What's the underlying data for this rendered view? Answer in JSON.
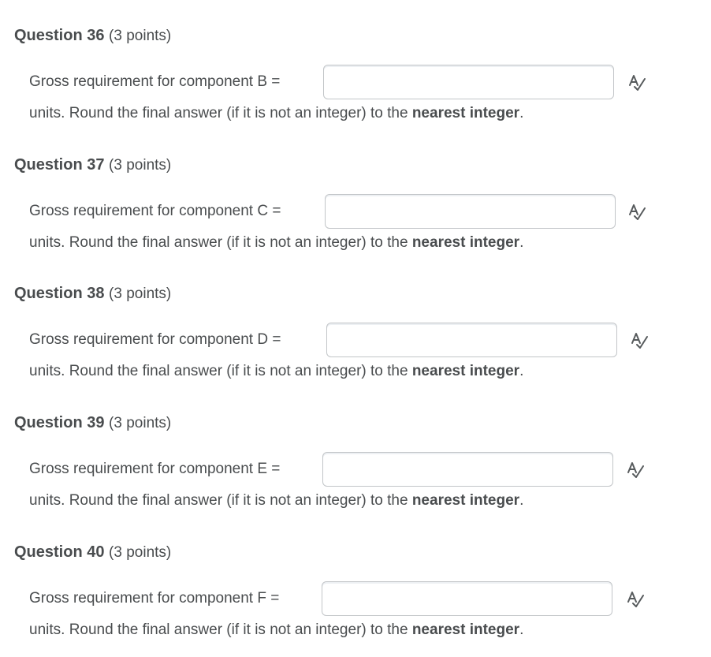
{
  "questions": [
    {
      "title": "Question 36",
      "points": "(3 points)",
      "prompt": "Gross requirement for component B =",
      "answer_value": "",
      "instruction_prefix": "units. Round the final answer (if it is not an integer) to the",
      "instruction_bold": "nearest integer",
      "instruction_suffix": "."
    },
    {
      "title": "Question 37",
      "points": "(3 points)",
      "prompt": "Gross requirement for component C =",
      "answer_value": "",
      "instruction_prefix": "units. Round the final answer (if it is not an integer) to the",
      "instruction_bold": "nearest integer",
      "instruction_suffix": "."
    },
    {
      "title": "Question 38",
      "points": "(3 points)",
      "prompt": "Gross requirement for component D =",
      "answer_value": "",
      "instruction_prefix": "units. Round the final answer (if it is not an integer) to the",
      "instruction_bold": "nearest integer",
      "instruction_suffix": "."
    },
    {
      "title": "Question 39",
      "points": "(3 points)",
      "prompt": "Gross requirement for component E =",
      "answer_value": "",
      "instruction_prefix": "units. Round the final answer (if it is not an integer) to the",
      "instruction_bold": "nearest integer",
      "instruction_suffix": "."
    },
    {
      "title": "Question 40",
      "points": "(3 points)",
      "prompt": "Gross requirement for component F =",
      "answer_value": "",
      "instruction_prefix": "units. Round the final answer (if it is not an integer) to the",
      "instruction_bold": "nearest integer",
      "instruction_suffix": "."
    }
  ],
  "icons": {
    "spell_check": "spell-check-icon"
  },
  "colors": {
    "text": "#494c4e",
    "input_border": "#c2c5c8",
    "icon": "#565a5c"
  }
}
